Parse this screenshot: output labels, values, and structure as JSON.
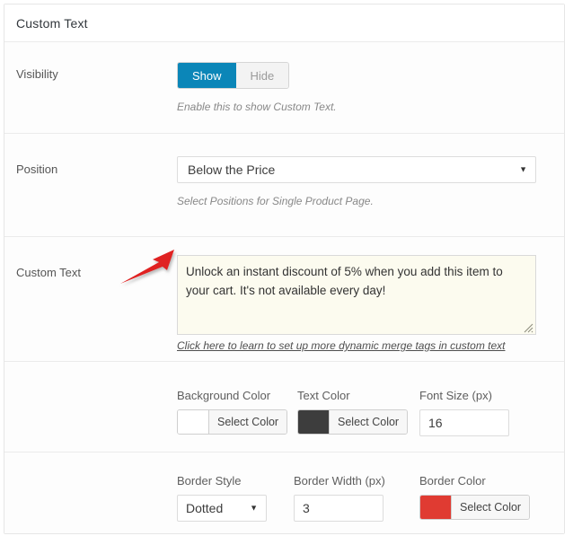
{
  "panel": {
    "title": "Custom Text"
  },
  "visibility": {
    "label": "Visibility",
    "options": [
      "Show",
      "Hide"
    ],
    "selected": "Show",
    "show_label": "Show",
    "hide_label": "Hide",
    "help": "Enable this to show Custom Text.",
    "active_color": "#0b86b8"
  },
  "position": {
    "label": "Position",
    "value": "Below the Price",
    "caret_icon": "chevron-down-icon",
    "help": "Select Positions for Single Product Page."
  },
  "custom_text": {
    "label": "Custom Text",
    "value": "Unlock an instant discount of 5% when you add this item to your cart. It's not available every day!",
    "background_color": "#fcfbef",
    "merge_tag_link": "Click here to learn to set up more dynamic merge tags in custom text"
  },
  "styles_row": {
    "background_color": {
      "label": "Background Color",
      "button_label": "Select Color",
      "swatch": "#ffffff"
    },
    "text_color": {
      "label": "Text Color",
      "button_label": "Select Color",
      "swatch": "#3d3d3d"
    },
    "font_size": {
      "label": "Font Size (px)",
      "value": "16"
    }
  },
  "border_row": {
    "border_style": {
      "label": "Border Style",
      "value": "Dotted",
      "caret_icon": "chevron-down-icon"
    },
    "border_width": {
      "label": "Border Width (px)",
      "value": "3"
    },
    "border_color": {
      "label": "Border Color",
      "button_label": "Select Color",
      "swatch": "#e03b32"
    }
  },
  "annotation": {
    "arrow_icon": "red-arrow-pointer",
    "color": "#e02020"
  }
}
